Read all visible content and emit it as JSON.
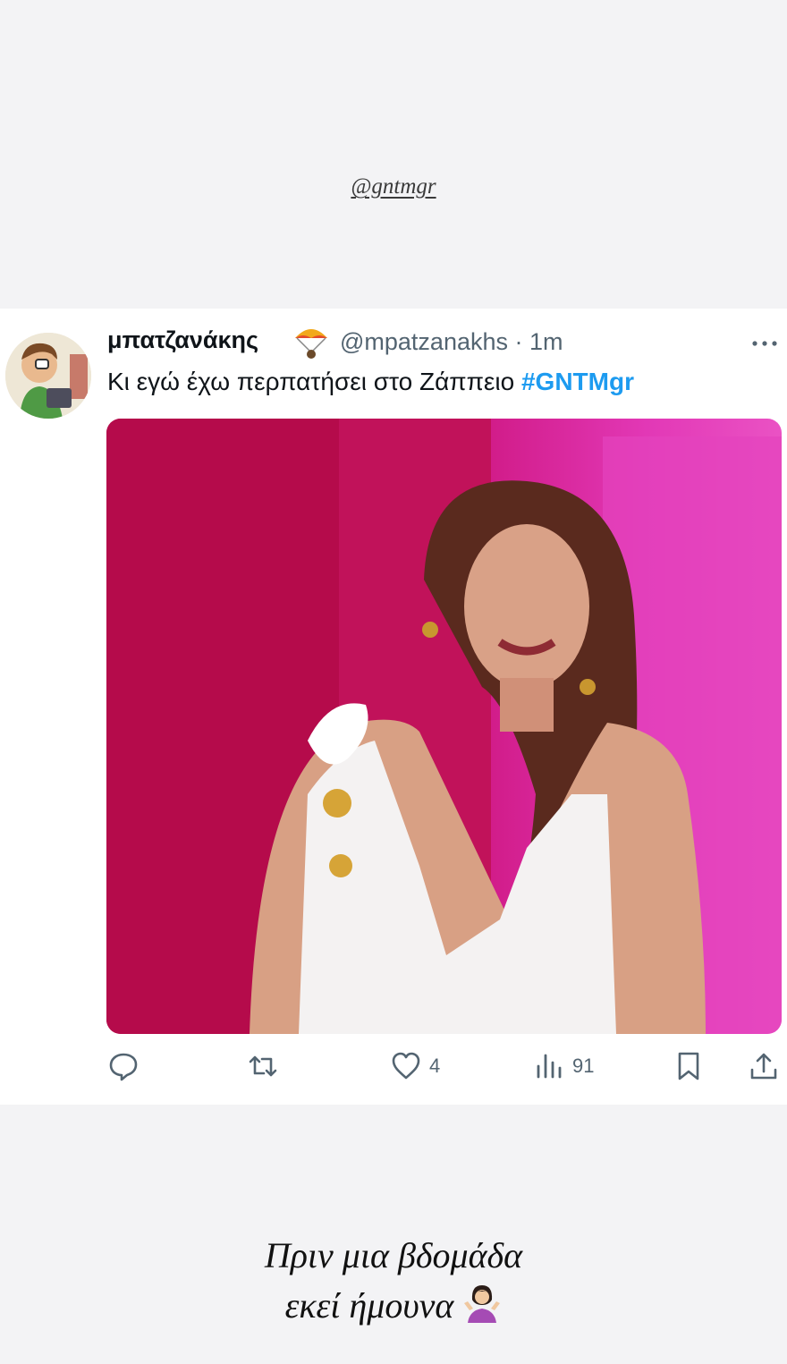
{
  "story": {
    "mention": "@gntmgr",
    "caption_line1": "Πριν μια βδομάδα",
    "caption_line2": "εκεί ήμουνα",
    "caption_emoji": "person-shrugging-icon"
  },
  "tweet": {
    "author_name": "μπατζανάκης",
    "author_emoji": "parachute-icon",
    "handle_time": "@mpatzanakhs · 1m",
    "text": "Κι εγώ έχω περπατήσει στο Ζάππειο ",
    "hashtag": "#GNTMgr",
    "actions": {
      "reply_count": "",
      "retweet_count": "",
      "like_count": "4",
      "views_count": "91"
    }
  },
  "colors": {
    "link": "#1d9bf0",
    "text": "#0f1419",
    "secondary": "#536471",
    "media_background": "#c51457"
  }
}
